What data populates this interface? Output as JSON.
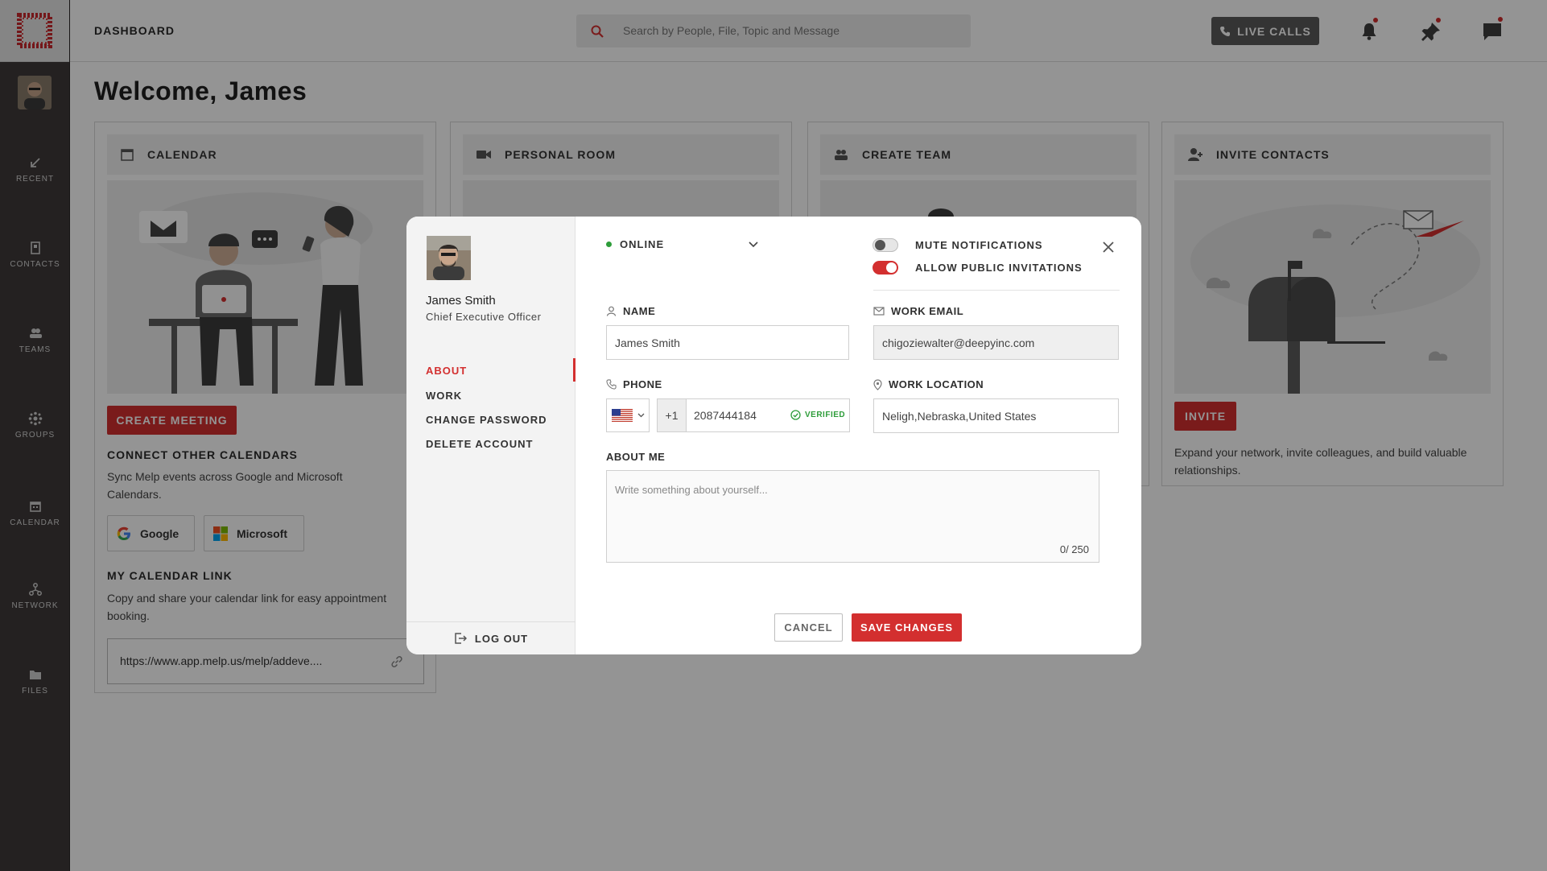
{
  "header": {
    "title": "DASHBOARD",
    "search_placeholder": "Search by People, File, Topic and Message",
    "live_calls": "LIVE CALLS"
  },
  "sidebar": {
    "items": [
      {
        "label": "RECENT",
        "icon": "arrow-down-left-icon"
      },
      {
        "label": "CONTACTS",
        "icon": "contacts-icon"
      },
      {
        "label": "TEAMS",
        "icon": "teams-icon"
      },
      {
        "label": "GROUPS",
        "icon": "groups-icon"
      },
      {
        "label": "CALENDAR",
        "icon": "calendar-icon"
      },
      {
        "label": "NETWORK",
        "icon": "network-icon"
      },
      {
        "label": "FILES",
        "icon": "folder-icon"
      }
    ]
  },
  "main": {
    "welcome": "Welcome, James",
    "cards": [
      {
        "title": "CALENDAR",
        "icon": "calendar-icon"
      },
      {
        "title": "PERSONAL ROOM",
        "icon": "video-icon"
      },
      {
        "title": "CREATE TEAM",
        "icon": "team-icon"
      },
      {
        "title": "INVITE CONTACTS",
        "icon": "add-user-icon"
      }
    ],
    "calendar": {
      "create_meeting": "CREATE MEETING",
      "connect_title": "CONNECT OTHER CALENDARS",
      "connect_desc": "Sync Melp events across Google and Microsoft Calendars.",
      "google": "Google",
      "microsoft": "Microsoft",
      "link_title": "MY CALENDAR LINK",
      "link_desc": "Copy and share your calendar link for easy appointment booking.",
      "link_value": "https://www.app.melp.us/melp/addeve...."
    },
    "invite": {
      "button": "INVITE",
      "desc": "Expand your network, invite colleagues, and build valuable relationships."
    }
  },
  "modal": {
    "user_name": "James Smith",
    "user_role": "Chief Executive Officer",
    "nav": [
      "ABOUT",
      "WORK",
      "CHANGE PASSWORD",
      "DELETE ACCOUNT"
    ],
    "logout": "LOG OUT",
    "status": "ONLINE",
    "mute_label": "MUTE NOTIFICATIONS",
    "mute_on": false,
    "allow_label": "ALLOW PUBLIC INVITATIONS",
    "allow_on": true,
    "name_label": "NAME",
    "name_value": "James Smith",
    "email_label": "WORK EMAIL",
    "email_value": "chigoziewalter@deepyinc.com",
    "phone_label": "PHONE",
    "phone_code": "+1",
    "phone_value": "2087444184",
    "verified": "VERIFIED",
    "location_label": "WORK LOCATION",
    "location_value": "Neligh,Nebraska,United States",
    "about_label": "ABOUT ME",
    "about_placeholder": "Write something about yourself...",
    "about_count": "0/ 250",
    "cancel": "CANCEL",
    "save": "SAVE CHANGES"
  },
  "colors": {
    "accent": "#d32f2f",
    "sidebar": "#3e3a39",
    "online": "#2e9d3a"
  }
}
